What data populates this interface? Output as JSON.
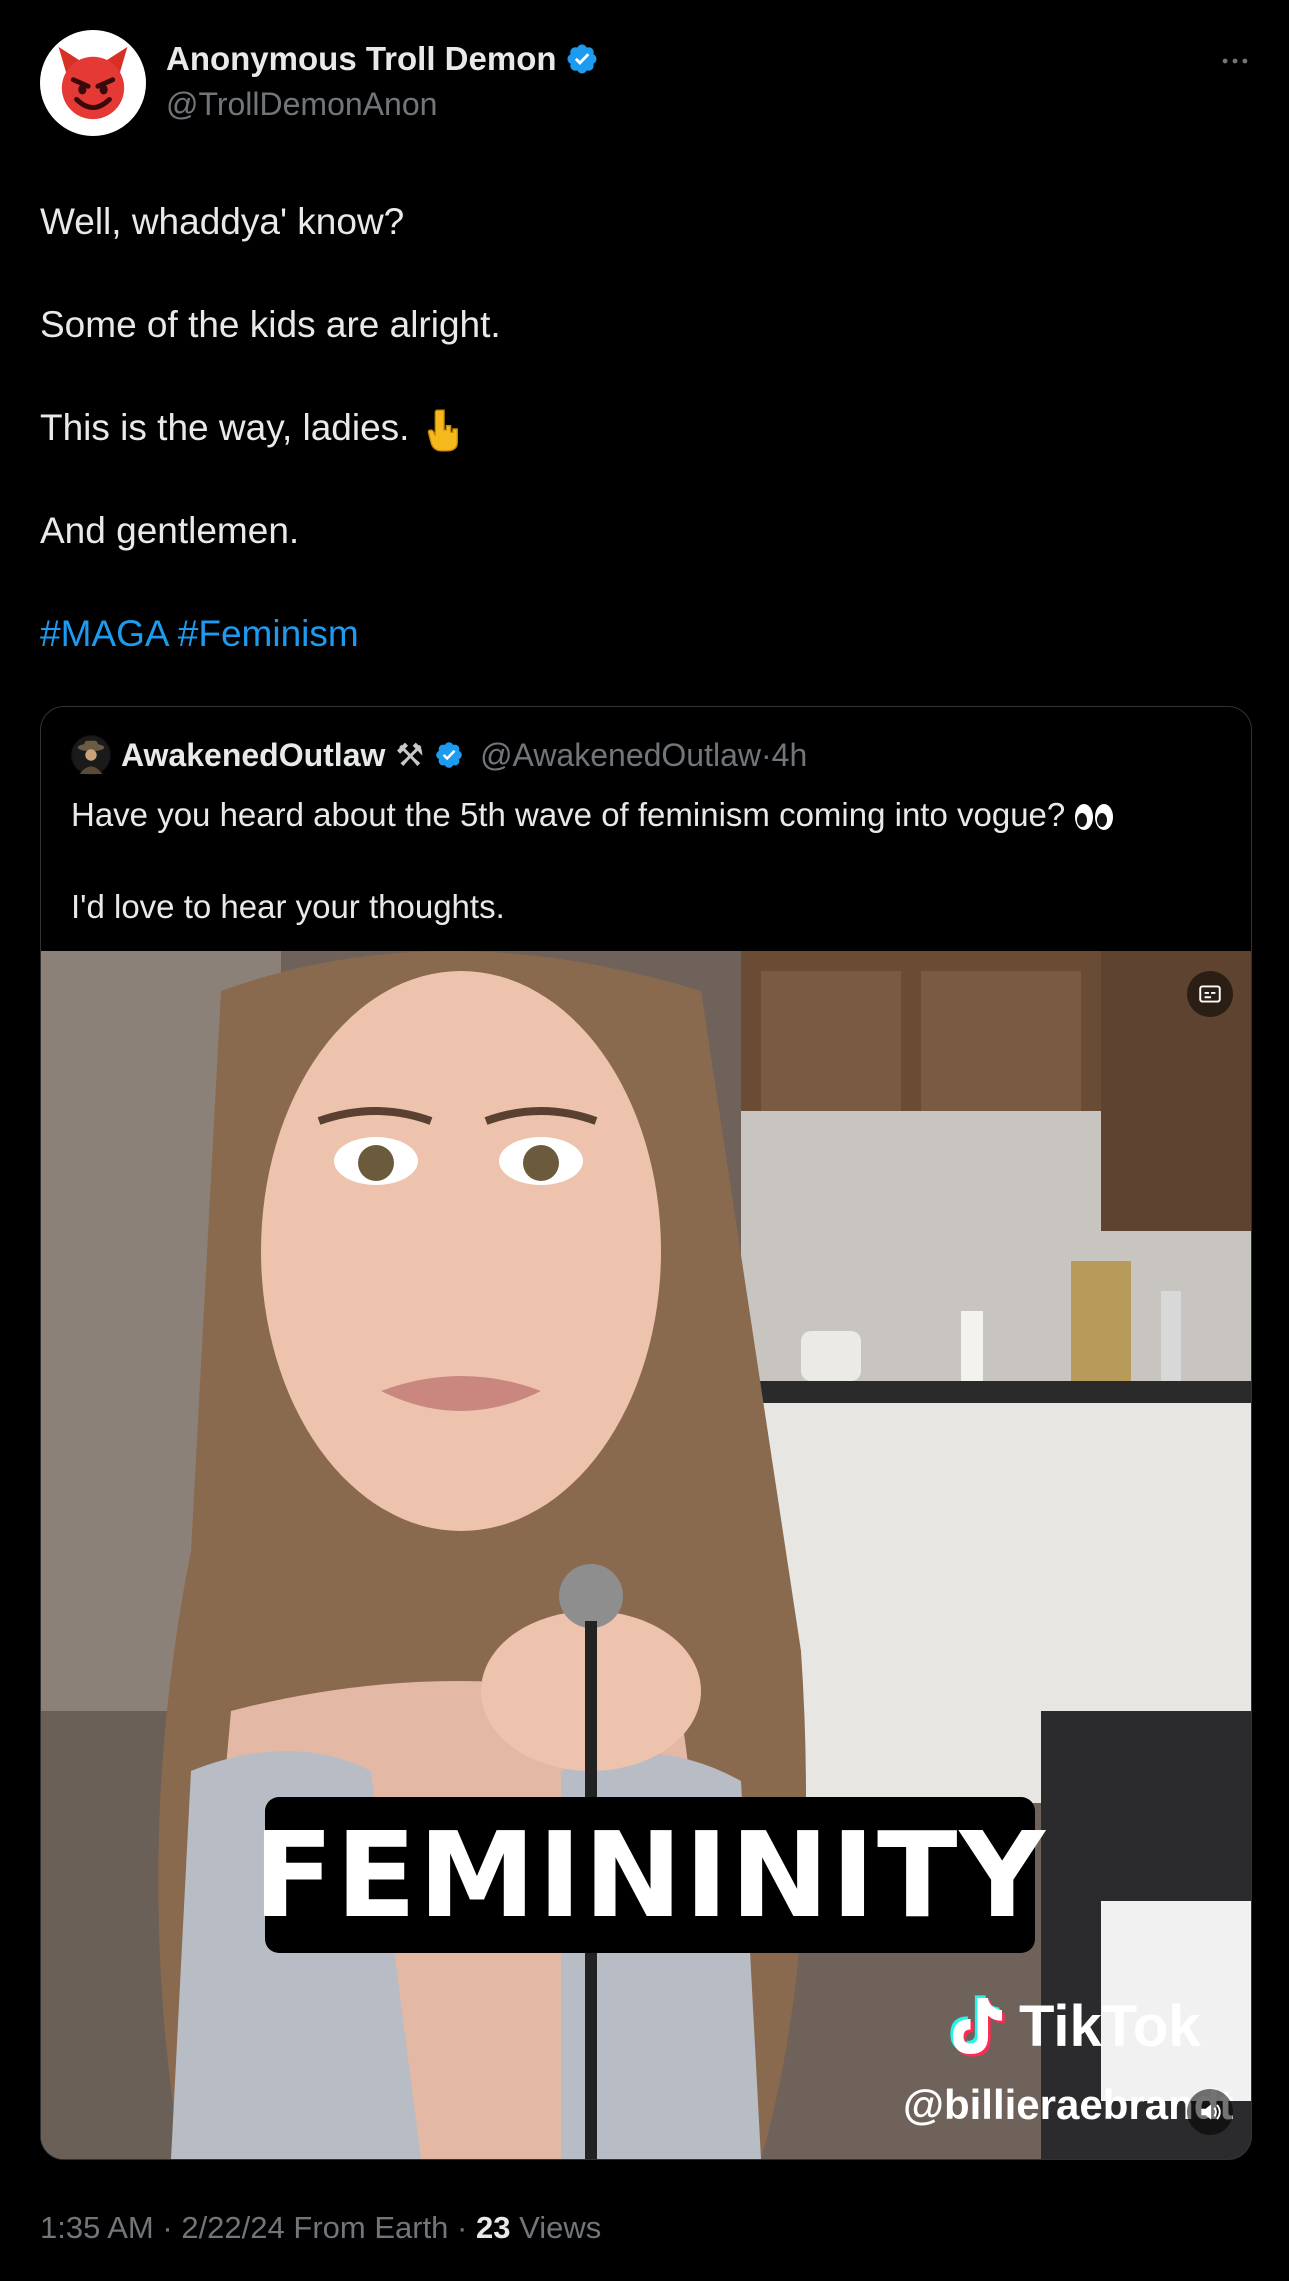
{
  "author": {
    "display_name": "Anonymous Troll Demon",
    "handle": "@TrollDemonAnon",
    "avatar_icon": "smiling-devil-icon",
    "verified": true
  },
  "tweet": {
    "paragraphs": [
      "Well, whaddya' know?",
      "Some of the kids are alright.",
      "This is the way, ladies.",
      "And gentlemen."
    ],
    "pointing_emoji": "point-down-icon",
    "hashtags": [
      "#MAGA",
      "#Feminism"
    ]
  },
  "quote": {
    "display_name": "AwakenedOutlaw",
    "name_suffix": "⚒",
    "handle": "@AwakenedOutlaw",
    "separator": "·",
    "time": "4h",
    "line1": "Have you heard about the 5th wave of feminism coming into vogue?",
    "line2": "I'd love to hear your thoughts.",
    "video": {
      "caption": "FEMININITY",
      "watermark_brand": "TikTok",
      "watermark_user": "@billieraebrandt"
    }
  },
  "footer": {
    "time": "1:35 AM",
    "sep1": "·",
    "date": "2/22/24",
    "source": "From Earth",
    "sep2": "·",
    "views_count": "23",
    "views_label": "Views"
  },
  "colors": {
    "background": "#000000",
    "text": "#e7e9ea",
    "muted": "#71767b",
    "link": "#1d9bf0",
    "verified": "#1d9bf0",
    "border": "#2f3336"
  }
}
